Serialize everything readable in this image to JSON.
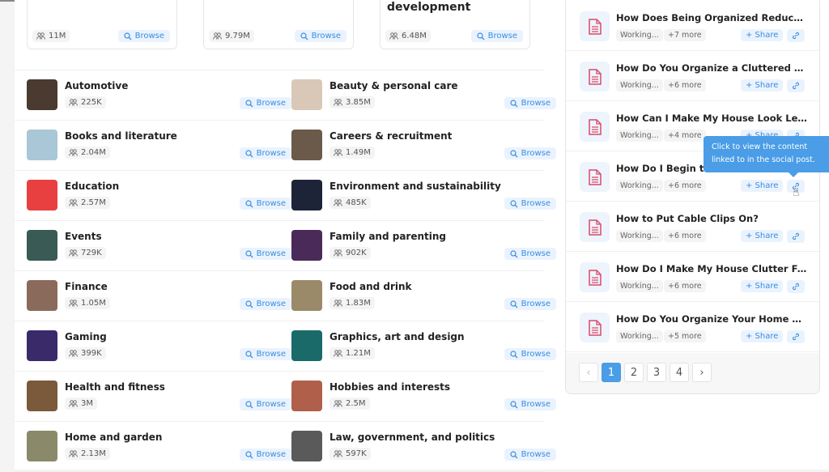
{
  "top_cards": [
    {
      "title": "",
      "audience": "11M",
      "browse": "Browse"
    },
    {
      "title": "",
      "audience": "9.79M",
      "browse": "Browse"
    },
    {
      "title": "development",
      "audience": "6.48M",
      "browse": "Browse"
    }
  ],
  "categories": [
    {
      "name": "Automotive",
      "audience": "225K",
      "color": "#4a3a30"
    },
    {
      "name": "Beauty & personal care",
      "audience": "3.85M",
      "color": "#d9c8b8"
    },
    {
      "name": "Books and literature",
      "audience": "2.04M",
      "color": "#a9c7d6"
    },
    {
      "name": "Careers & recruitment",
      "audience": "1.49M",
      "color": "#6b5a4a"
    },
    {
      "name": "Education",
      "audience": "2.57M",
      "color": "#e84040"
    },
    {
      "name": "Environment and sustainability",
      "audience": "485K",
      "color": "#1e2438"
    },
    {
      "name": "Events",
      "audience": "729K",
      "color": "#3a5a55"
    },
    {
      "name": "Family and parenting",
      "audience": "902K",
      "color": "#4a2a58"
    },
    {
      "name": "Finance",
      "audience": "1.05M",
      "color": "#8a6a5a"
    },
    {
      "name": "Food and drink",
      "audience": "1.83M",
      "color": "#9a8a6a"
    },
    {
      "name": "Gaming",
      "audience": "399K",
      "color": "#3a2a6a"
    },
    {
      "name": "Graphics, art and design",
      "audience": "1.21M",
      "color": "#1a6a6a"
    },
    {
      "name": "Health and fitness",
      "audience": "3M",
      "color": "#7a5a3a"
    },
    {
      "name": "Hobbies and interests",
      "audience": "2.5M",
      "color": "#b0604a"
    },
    {
      "name": "Home and garden",
      "audience": "2.13M",
      "color": "#8a8a6a"
    },
    {
      "name": "Law, government, and politics",
      "audience": "597K",
      "color": "#5a5a5a"
    }
  ],
  "browse_label": "Browse",
  "content_items": [
    {
      "title": "How Does Being Organized Reduce Stress?",
      "tag": "Working...",
      "more": "+7 more"
    },
    {
      "title": "How Do You Organize a Cluttered House?",
      "tag": "Working...",
      "more": "+6 more"
    },
    {
      "title": "How Can I Make My House Look Less Cluttered?",
      "tag": "Working...",
      "more": "+4 more"
    },
    {
      "title": "How Do I Begin to",
      "tag": "Working...",
      "more": "+6 more"
    },
    {
      "title": "How to Put Cable Clips On?",
      "tag": "Working...",
      "more": "+6 more"
    },
    {
      "title": "How Do I Make My House Clutter Free?",
      "tag": "Working...",
      "more": "+6 more"
    },
    {
      "title": "How Do You Organize Your Home Office?",
      "tag": "Working...",
      "more": "+5 more"
    }
  ],
  "share_label": "+ Share",
  "pagination": {
    "prev": "‹",
    "pages": [
      "1",
      "2",
      "3",
      "4"
    ],
    "current": "1",
    "next": "›"
  },
  "tooltip": "Click to view the content linked to in the social post.",
  "accent": "#4a9de6"
}
